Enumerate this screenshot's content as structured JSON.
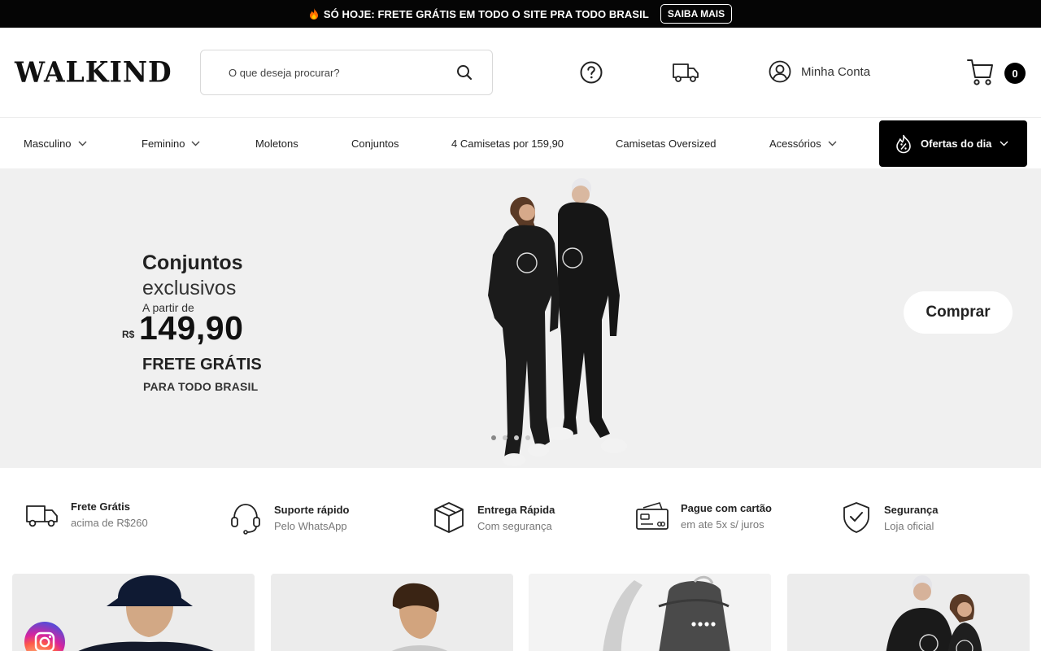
{
  "announcement": {
    "text": "SÓ HOJE: FRETE GRÁTIS EM TODO O SITE PRA TODO BRASIL",
    "button": "SAIBA MAIS"
  },
  "header": {
    "logo": "WALKIND",
    "search_placeholder": "O que deseja procurar?",
    "account_label": "Minha Conta",
    "cart_count": "0"
  },
  "nav": {
    "items": [
      {
        "label": "Masculino",
        "has_dropdown": true
      },
      {
        "label": "Feminino",
        "has_dropdown": true
      },
      {
        "label": "Moletons",
        "has_dropdown": false
      },
      {
        "label": "Conjuntos",
        "has_dropdown": false
      },
      {
        "label": "4 Camisetas por 159,90",
        "has_dropdown": false
      },
      {
        "label": "Camisetas Oversized",
        "has_dropdown": false
      },
      {
        "label": "Acessórios",
        "has_dropdown": true
      }
    ],
    "offers_label": "Ofertas do dia"
  },
  "hero": {
    "title": "Conjuntos",
    "subtitle": "exclusivos",
    "from_label": "A partir de",
    "currency": "R$",
    "price": "149,90",
    "shipping": "FRETE GRÁTIS",
    "shipping_sub": "PARA TODO BRASIL",
    "button": "Comprar",
    "slides": 4,
    "active_slide": 1
  },
  "features": [
    {
      "title": "Frete Grátis",
      "subtitle": "acima de R$260",
      "icon": "truck-icon"
    },
    {
      "title": "Suporte rápido",
      "subtitle": "Pelo WhatsApp",
      "icon": "headset-icon"
    },
    {
      "title": "Entrega Rápida",
      "subtitle": "Com segurança",
      "icon": "box-icon"
    },
    {
      "title": "Pague com cartão",
      "subtitle": "em ate 5x s/ juros",
      "icon": "credit-card-icon"
    },
    {
      "title": "Segurança",
      "subtitle": "Loja oficial",
      "icon": "shield-check-icon"
    }
  ],
  "colors": {
    "topbar": "#050505",
    "hero_bg": "#f0f0f0",
    "offers_bg": "#000000"
  }
}
